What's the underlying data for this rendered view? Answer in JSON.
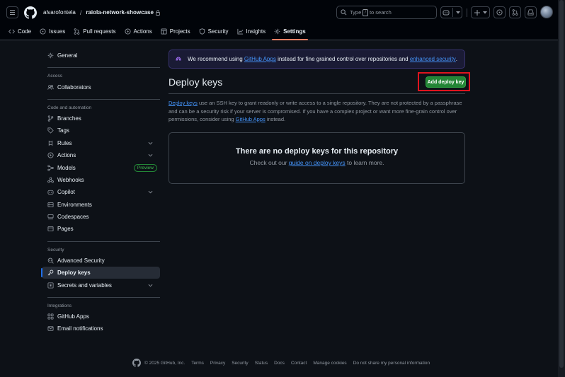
{
  "header": {
    "owner": "alvarofontela",
    "separator": "/",
    "repo": "raiola-network-showcase",
    "search_prefix": "Type",
    "search_key": "/",
    "search_suffix": "to search"
  },
  "nav": {
    "tabs": [
      {
        "label": "Code",
        "icon": "code-icon"
      },
      {
        "label": "Issues",
        "icon": "issue-icon"
      },
      {
        "label": "Pull requests",
        "icon": "pull-request-icon"
      },
      {
        "label": "Actions",
        "icon": "play-icon"
      },
      {
        "label": "Projects",
        "icon": "table-icon"
      },
      {
        "label": "Security",
        "icon": "shield-icon"
      },
      {
        "label": "Insights",
        "icon": "graph-icon"
      },
      {
        "label": "Settings",
        "icon": "gear-icon",
        "active": true
      }
    ]
  },
  "sidebar": {
    "general": "General",
    "access_heading": "Access",
    "collaborators": "Collaborators",
    "code_heading": "Code and automation",
    "branches": "Branches",
    "tags": "Tags",
    "rules": "Rules",
    "actions": "Actions",
    "models": "Models",
    "models_badge": "Preview",
    "webhooks": "Webhooks",
    "copilot": "Copilot",
    "environments": "Environments",
    "codespaces": "Codespaces",
    "pages": "Pages",
    "security_heading": "Security",
    "advanced_security": "Advanced Security",
    "deploy_keys": "Deploy keys",
    "secrets": "Secrets and variables",
    "integrations_heading": "Integrations",
    "github_apps": "GitHub Apps",
    "email_notifications": "Email notifications"
  },
  "banner": {
    "pre": "We recommend using",
    "link1": "GitHub Apps",
    "mid": "instead for fine grained control over repositories and",
    "link2": "enhanced security",
    "end": "."
  },
  "main": {
    "title": "Deploy keys",
    "add_button": "Add deploy key",
    "desc_link": "Deploy keys",
    "desc_body": "use an SSH key to grant readonly or write access to a single repository. They are not protected by a passphrase and can be a security risk if your server is compromised. If you have a complex project or want more fine-grain control over permissions, consider using",
    "desc_link2": "GitHub Apps",
    "desc_end": "instead.",
    "empty_title": "There are no deploy keys for this repository",
    "empty_pre": "Check out our",
    "empty_link": "guide on deploy keys",
    "empty_post": "to learn more."
  },
  "footer": {
    "copyright": "© 2025 GitHub, Inc.",
    "links": [
      "Terms",
      "Privacy",
      "Security",
      "Status",
      "Docs",
      "Contact",
      "Manage cookies",
      "Do not share my personal information"
    ]
  },
  "colors": {
    "background": "#0d1117",
    "accent_green": "#238636",
    "link": "#4493f8",
    "highlight_red": "#e0141e"
  }
}
